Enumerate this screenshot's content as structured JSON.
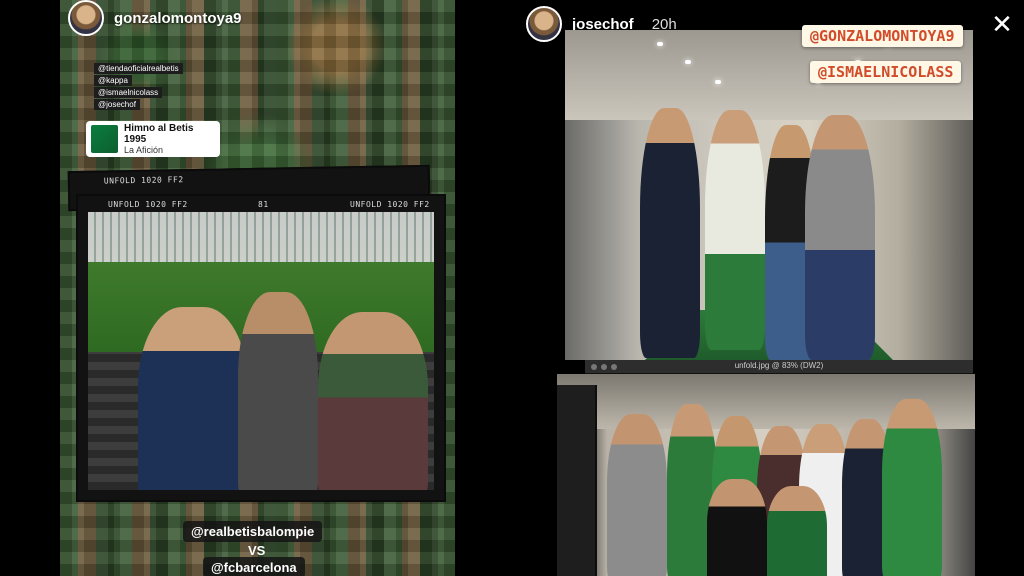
{
  "left_story": {
    "username": "gonzalomontoya9",
    "tags": [
      "@tiendaoficialrealbetis",
      "@kappa",
      "@ismaelnicolass",
      "@josechof"
    ],
    "music": {
      "title": "Himno al Betis 1995",
      "artist": "La Afición"
    },
    "photo_captions": {
      "back": "UNFOLD 1020 FF2",
      "main_left": "UNFOLD 1020 FF2",
      "main_mid": "81",
      "main_right": "UNFOLD 1020 FF2"
    },
    "mention_1": "@realbetisbalompie",
    "vs_text": "VS",
    "mention_2": "@fcbarcelona"
  },
  "right_story": {
    "username": "josechof",
    "timestamp": "20h",
    "mentions": [
      "@GONZALOMONTOYA9",
      "@ISMAELNICOLASS"
    ],
    "window_title": "unfold.jpg @ 83% (DW2)"
  },
  "colors": {
    "accent_green": "#0a7d3e",
    "mention_red": "#d24b2a",
    "sticker_bg": "#fff8e6"
  },
  "icons": {
    "close": "close-icon"
  }
}
